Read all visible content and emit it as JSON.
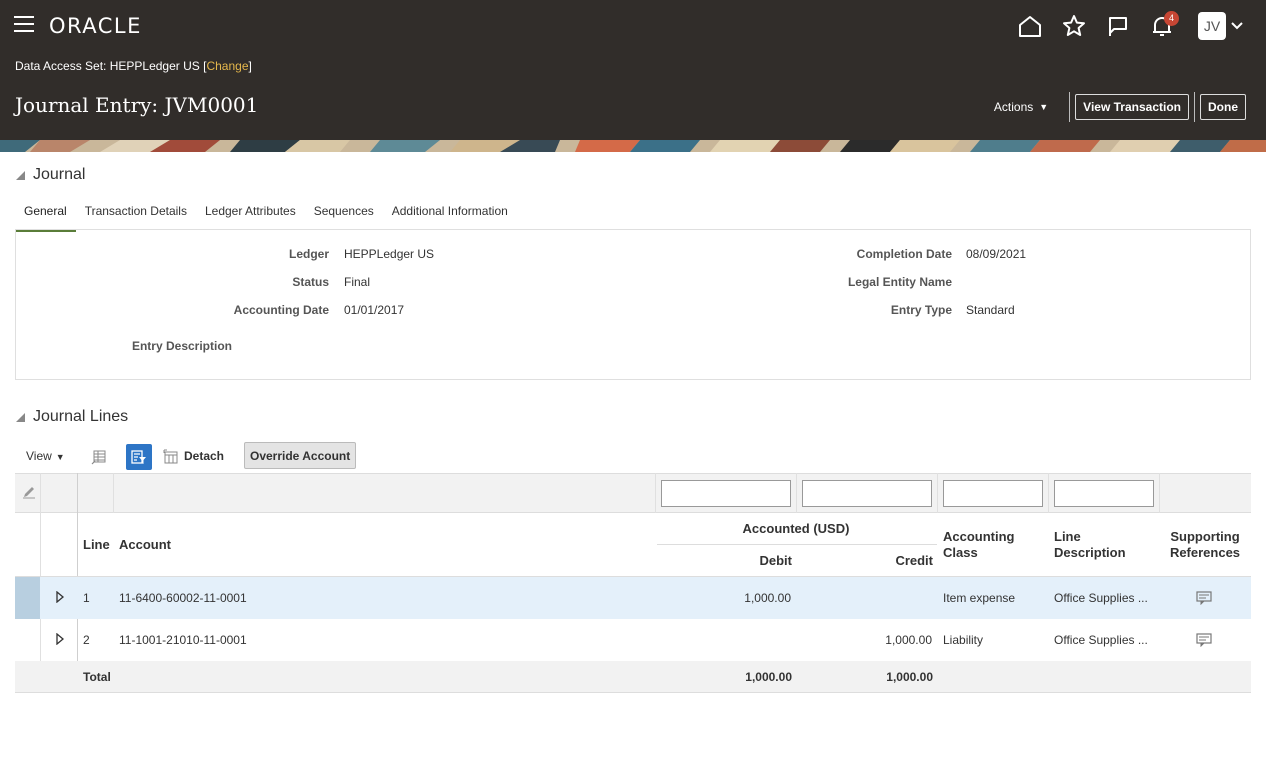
{
  "header": {
    "brand": "ORACLE",
    "notification_count": "4",
    "user_initials": "JV",
    "data_access_label": "Data Access Set:",
    "data_access_value": "HEPPLedger US",
    "bracket_open": "[",
    "change_link": "Change",
    "bracket_close": "]",
    "page_title": "Journal Entry: JVM0001",
    "actions_label": "Actions",
    "view_transaction_label": "View Transaction",
    "done_label": "Done"
  },
  "journal": {
    "section_title": "Journal",
    "tabs": [
      "General",
      "Transaction Details",
      "Ledger Attributes",
      "Sequences",
      "Additional Information"
    ],
    "active_tab": "General",
    "fields": {
      "ledger_label": "Ledger",
      "ledger_value": "HEPPLedger US",
      "status_label": "Status",
      "status_value": "Final",
      "accounting_date_label": "Accounting Date",
      "accounting_date_value": "01/01/2017",
      "entry_description_label": "Entry Description",
      "completion_date_label": "Completion Date",
      "completion_date_value": "08/09/2021",
      "legal_entity_label": "Legal Entity Name",
      "entry_type_label": "Entry Type",
      "entry_type_value": "Standard"
    }
  },
  "journal_lines": {
    "section_title": "Journal Lines",
    "toolbar": {
      "view_label": "View",
      "detach_label": "Detach",
      "override_label": "Override Account"
    },
    "columns": {
      "line": "Line",
      "account": "Account",
      "accounted": "Accounted (USD)",
      "debit": "Debit",
      "credit": "Credit",
      "accounting_class_1": "Accounting",
      "accounting_class_2": "Class",
      "line_description_1": "Line",
      "line_description_2": "Description",
      "supporting_refs_1": "Supporting",
      "supporting_refs_2": "References"
    },
    "rows": [
      {
        "line": "1",
        "account": "11-6400-60002-11-0001",
        "debit": "1,000.00",
        "credit": "",
        "accounting_class": "Item expense",
        "line_description": "Office Supplies ..."
      },
      {
        "line": "2",
        "account": "11-1001-21010-11-0001",
        "debit": "",
        "credit": "1,000.00",
        "accounting_class": "Liability",
        "line_description": "Office Supplies ..."
      }
    ],
    "total": {
      "label": "Total",
      "debit": "1,000.00",
      "credit": "1,000.00"
    }
  },
  "colors": {
    "header_bg": "#312d2a",
    "selected_row": "#e4f0fa",
    "active_tab": "#5a7d39",
    "filter_active": "#2d75c6",
    "badge": "#c74634",
    "link": "#e6b84c"
  },
  "icons": [
    "hamburger-icon",
    "home-icon",
    "star-icon",
    "flag-icon",
    "bell-icon",
    "chevron-down-icon",
    "freeze-icon",
    "query-by-example-icon",
    "detach-icon",
    "edit-icon",
    "expand-icon",
    "supporting-references-icon"
  ]
}
